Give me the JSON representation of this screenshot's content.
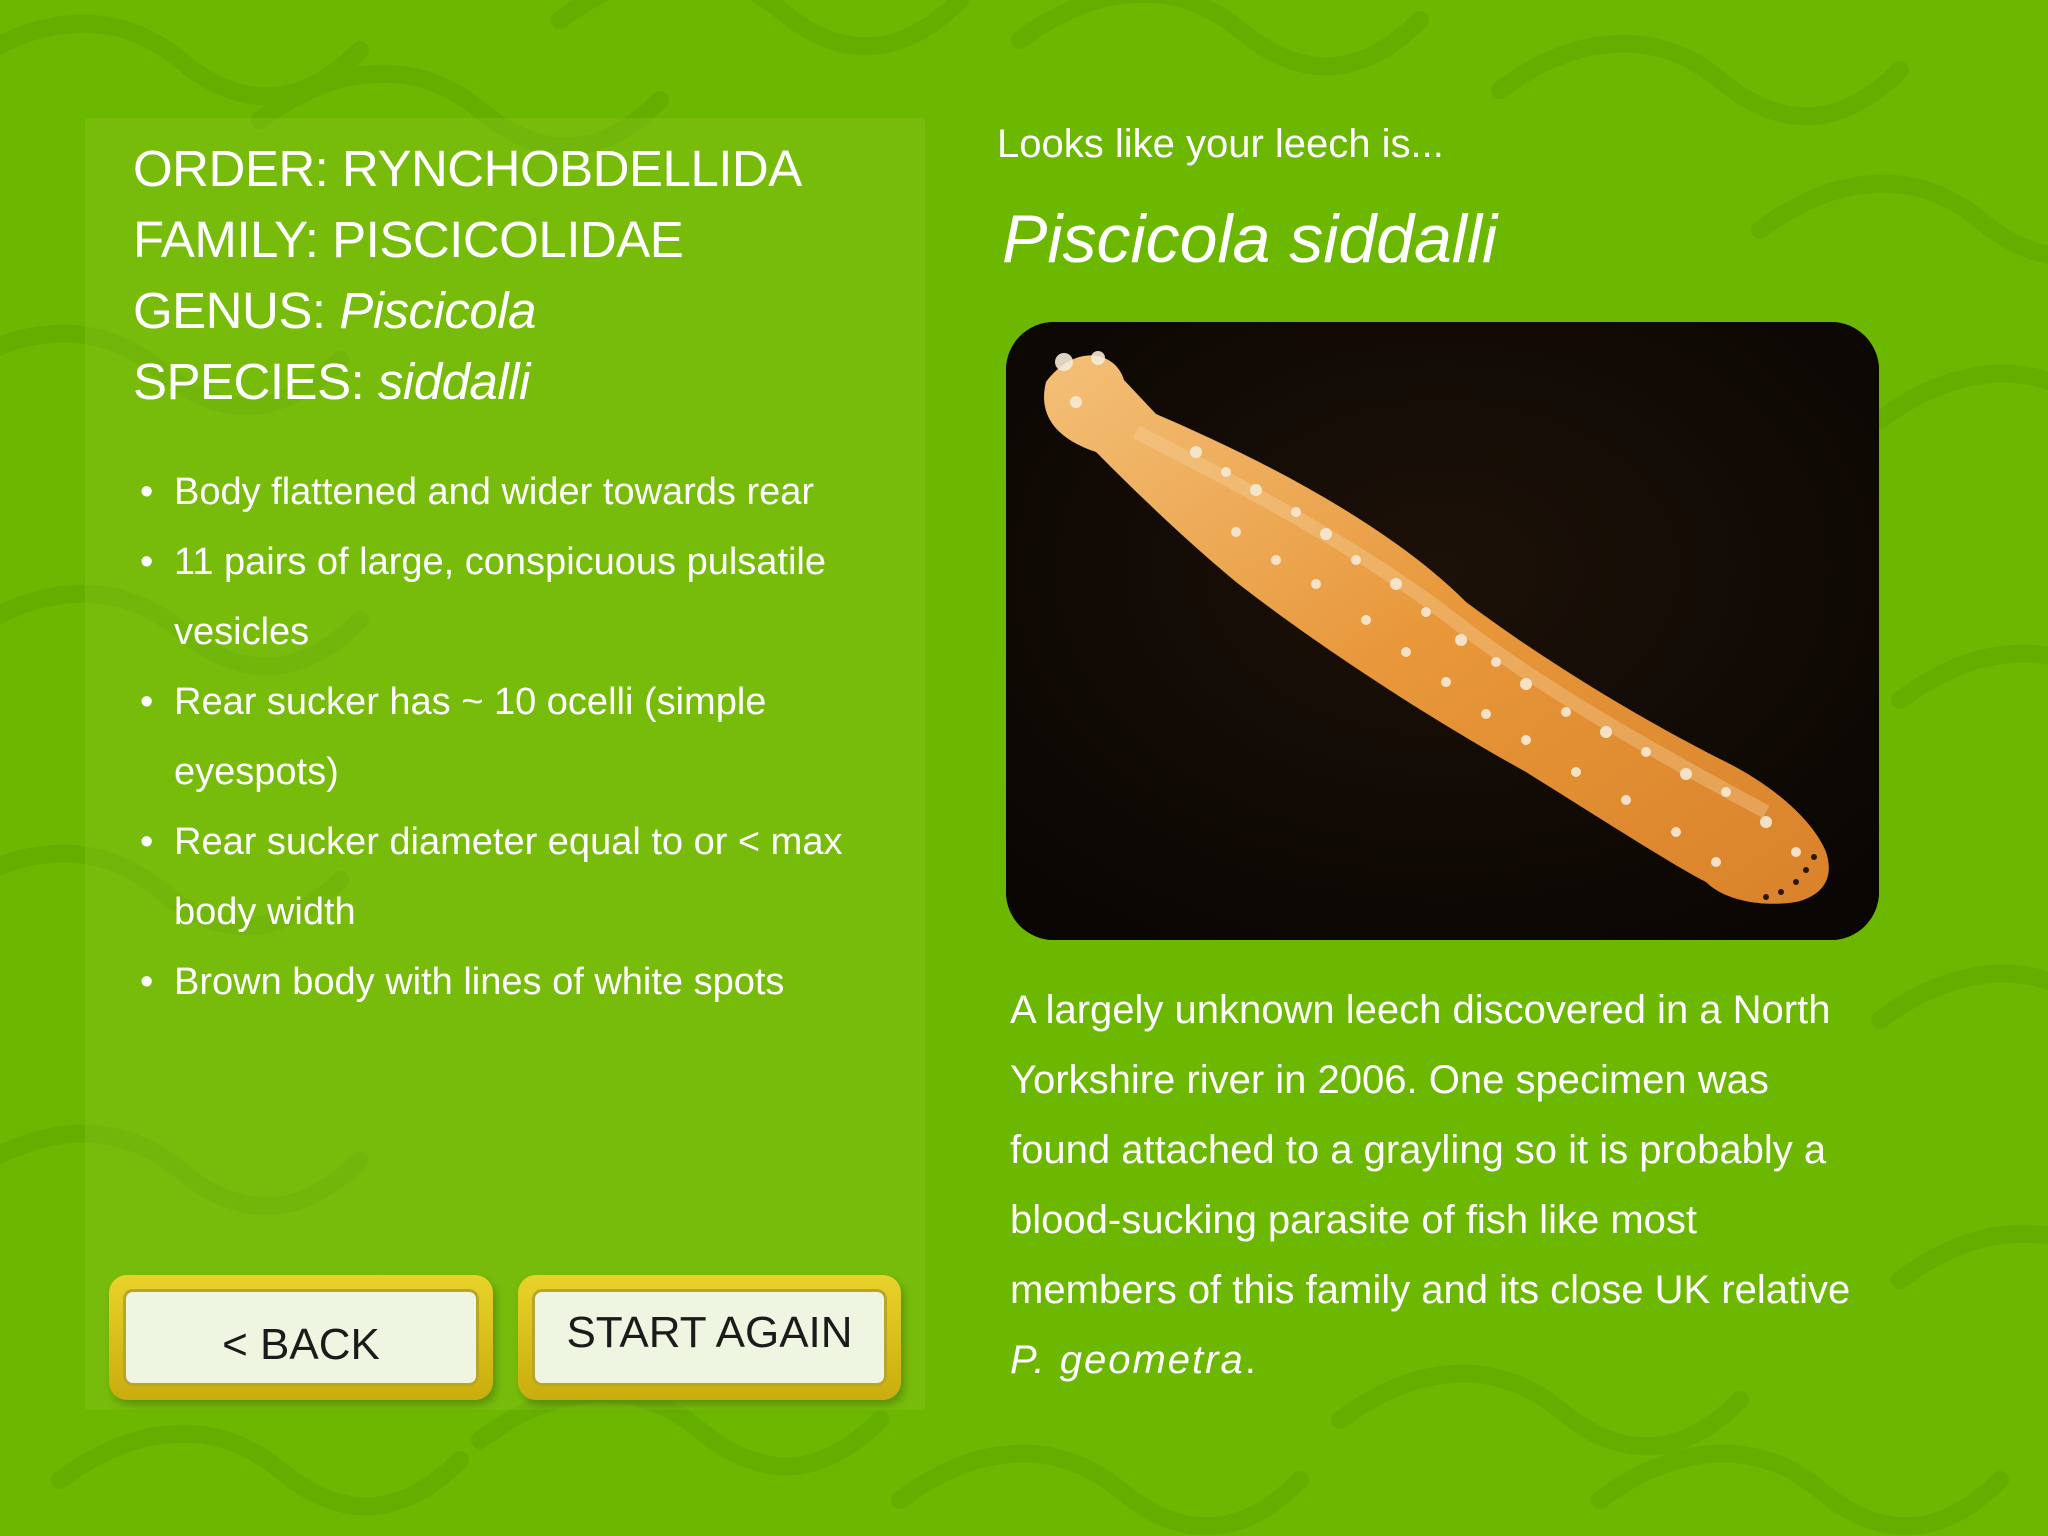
{
  "taxonomy": {
    "order_label": "ORDER: ",
    "order_value": "RYNCHOBDELLIDA",
    "family_label": "FAMILY: ",
    "family_value": "PISCICOLIDAE",
    "genus_label": "GENUS: ",
    "genus_value": "Piscicola",
    "species_label": "SPECIES: ",
    "species_value": "siddalli"
  },
  "features": [
    "Body flattened and wider towards rear",
    "11 pairs of large, conspicuous pulsatile vesicles",
    "Rear sucker has ~ 10 ocelli (simple eyespots)",
    "Rear sucker diameter equal to or < max body width",
    "Brown body with lines of white spots"
  ],
  "bullet_char": "•",
  "buttons": {
    "back_label": "< BACK",
    "start_again_label": "START AGAIN"
  },
  "result": {
    "lead": "Looks like your leech is...",
    "species_name": "Piscicola siddalli"
  },
  "description": {
    "text": "A largely unknown leech discovered in a North Yorkshire river in 2006. One specimen was found attached to a grayling so it is probably a blood-sucking parasite of fish like most members of this family and its close UK relative ",
    "relative": "P. geometra",
    "end": "."
  },
  "colors": {
    "background": "#6cb800",
    "button_frame": "#d9c01c",
    "button_face": "#eef6e2",
    "photo_background": "#120a04",
    "leech_body": "#e89a3c"
  },
  "icons": {
    "background_pattern": "leech-silhouette-pattern"
  }
}
